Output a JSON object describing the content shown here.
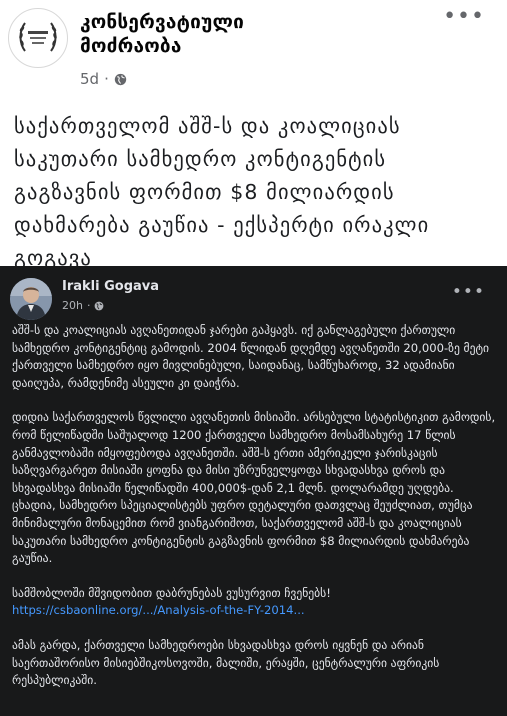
{
  "post": {
    "page_name_line1": "კონსერვატიული",
    "page_name_line2": "მოძრაობა",
    "time": "5d",
    "separator": "·",
    "more": "•••",
    "headline": "საქართველომ აშშ-ს და კოალიციას საკუთარი სამხედრო კონტიგენტის გაგზავნის ფორმით $8 მილიარდის დახმარება გაუწია - ექსპერტი ირაკლი გოგავა"
  },
  "shared_post": {
    "author": "Irakli Gogava",
    "time": "20h",
    "separator": "·",
    "more": "•••",
    "paragraph1": "აშშ-ს და კოალიციას ავღანეთიდან ჯარები გაჰყავს. იქ განლაგებული ქართული სამხედრო კონტიგენტიც გამოდის. 2004 წლიდან დღემდე ავღანეთში 20,000-ზე მეტი ქართველი სამხედრო იყო მივლინებული, საიდანაც, სამწუხაროდ, 32 ადამიანი დაიღუპა, რამდენიმე ასეული კი დაიჭრა.",
    "paragraph2": "დიდია საქართველოს წვლილი ავღანეთის მისიაში. არსებული სტატისტიკით გამოდის, რომ წელიწადში საშუალოდ 1200 ქართველი სამხედრო მოსამსახურე 17 წლის განმავლობაში იმყოფებოდა ავღანეთში. აშშ-ს ერთი ამერიკელი ჯარისკაცის საზღვარგარეთ მისიაში ყოფნა და მისი უზრუნველყოფა სხვადასხვა დროს და სხვადასხვა მისიაში წელიწადში 400,000$-დან 2,1 მლნ. დოლარამდე უღდება. ცხადია, სამხედრო სპეციალისტებს უფრო დეტალური დათვლაც შეუძლიათ, თუმცა მინიმალური მონაცემით რომ ვიანგარიშოთ, საქართველომ აშშ-ს და კოალიციას საკუთარი სამხედრო კონტიგენტის გაგზავნის ფორმით $8 მილიარდის დახმარება გაუწია.",
    "paragraph3_text": "სამშობლოში მშვიდობით დაბრუნებას ვუსურვით ჩვენებს!",
    "paragraph3_link": "https://csbaonline.org/.../Analysis-of-the-FY-2014...",
    "paragraph4": "ამას გარდა, ქართველი სამხედროები სხვადასხვა დროს იყვნენ და არიან საერთაშორისო მისიებშიკოსოვოში, მალიში, ერაყში, ცენტრალური აფრიკის რესპუბლიკაში."
  }
}
